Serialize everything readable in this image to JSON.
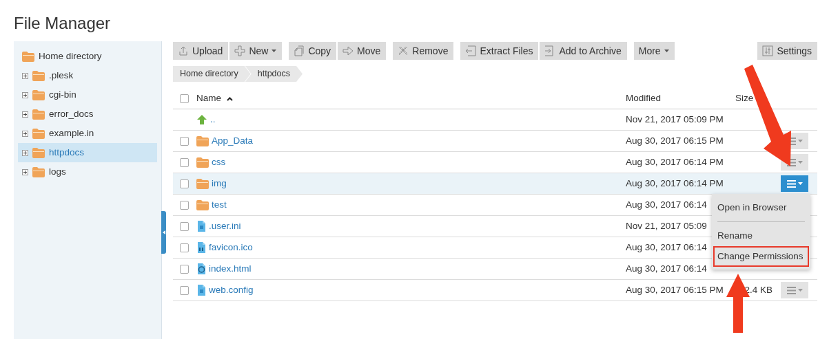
{
  "title": "File Manager",
  "sidebar": {
    "tree": [
      {
        "label": "Home directory",
        "selected": false,
        "children": [
          {
            "label": ".plesk",
            "expanded": false,
            "selected": false
          },
          {
            "label": "cgi-bin",
            "expanded": false,
            "selected": false
          },
          {
            "label": "error_docs",
            "expanded": false,
            "selected": false
          },
          {
            "label": "example.in",
            "expanded": false,
            "selected": false
          },
          {
            "label": "httpdocs",
            "expanded": false,
            "selected": true
          },
          {
            "label": "logs",
            "expanded": false,
            "selected": false
          }
        ]
      }
    ]
  },
  "toolbar": {
    "groups": [
      [
        {
          "label": "Upload",
          "kind": "upload"
        },
        {
          "label": "New",
          "kind": "new",
          "dropdown": true
        }
      ],
      [
        {
          "label": "Copy",
          "kind": "copy"
        },
        {
          "label": "Move",
          "kind": "move"
        }
      ],
      [
        {
          "label": "Remove",
          "kind": "remove"
        }
      ],
      [
        {
          "label": "Extract Files",
          "kind": "extract"
        },
        {
          "label": "Add to Archive",
          "kind": "archive"
        }
      ],
      [
        {
          "label": "More",
          "kind": "plain",
          "dropdown": true
        }
      ]
    ],
    "settings": {
      "label": "Settings",
      "kind": "settings"
    }
  },
  "breadcrumb": [
    "Home directory",
    "httpdocs"
  ],
  "table": {
    "select_all_checked": false,
    "columns": [
      {
        "label": "Name",
        "sort_ascending": true
      },
      {
        "label": "Modified"
      },
      {
        "label": "Size"
      }
    ],
    "rows": [
      {
        "kind": "parent",
        "name": "..",
        "modified": "Nov 21, 2017 05:09 PM",
        "selected": false
      },
      {
        "kind": "folder",
        "name": "App_Data",
        "modified": "Aug 30, 2017 06:15 PM",
        "checked": false,
        "selected": false,
        "menu_open": false
      },
      {
        "kind": "folder",
        "name": "css",
        "modified": "Aug 30, 2017 06:14 PM",
        "checked": false,
        "selected": false,
        "menu_open": false
      },
      {
        "kind": "folder",
        "name": "img",
        "modified": "Aug 30, 2017 06:14 PM",
        "checked": false,
        "selected": true,
        "menu_open": true
      },
      {
        "kind": "folder",
        "name": "test",
        "modified": "Aug 30, 2017 06:14",
        "checked": false,
        "selected": false
      },
      {
        "kind": "text",
        "name": ".user.ini",
        "modified": "Nov 21, 2017 05:09",
        "checked": false,
        "selected": false
      },
      {
        "kind": "binary",
        "name": "favicon.ico",
        "modified": "Aug 30, 2017 06:14",
        "checked": false,
        "selected": false
      },
      {
        "kind": "web",
        "name": "index.html",
        "modified": "Aug 30, 2017 06:14",
        "checked": false,
        "selected": false
      },
      {
        "kind": "text",
        "name": "web.config",
        "modified": "Aug 30, 2017 06:15 PM",
        "size": "2.4 KB",
        "checked": false,
        "selected": false,
        "menu_open": false
      }
    ]
  },
  "menu": {
    "items": [
      {
        "kind": "item",
        "label": "Open in Browser",
        "highlighted": false
      },
      {
        "kind": "divider"
      },
      {
        "kind": "item",
        "label": "Rename",
        "highlighted": false
      },
      {
        "kind": "item",
        "label": "Change Permissions",
        "highlighted": true
      }
    ]
  }
}
